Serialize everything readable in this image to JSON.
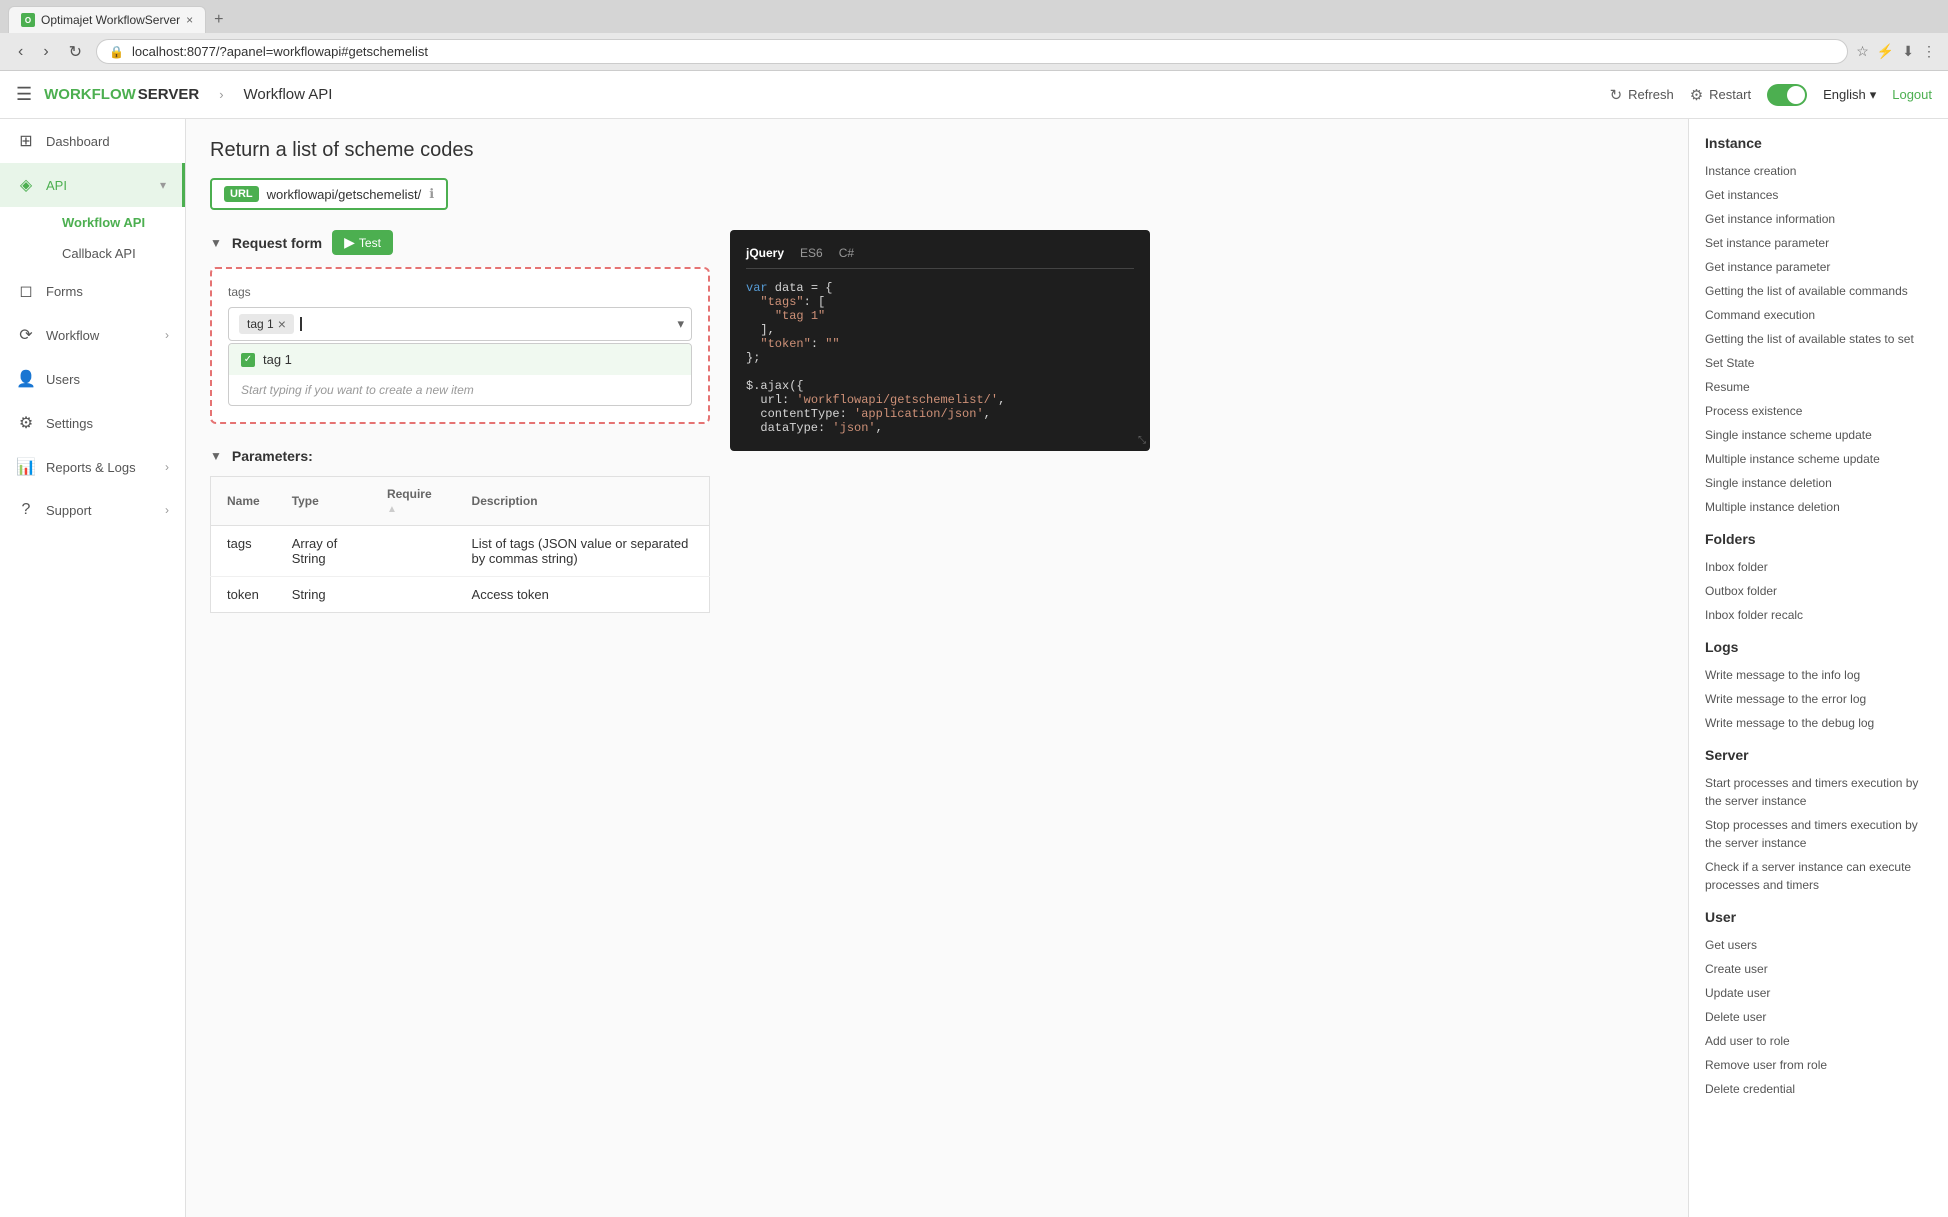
{
  "browser": {
    "tab_favicon": "O",
    "tab_title": "Optimajet WorkflowServer",
    "tab_close": "×",
    "tab_new": "+",
    "address": "localhost:8077/?apanel=workflowapi#getschemelist",
    "nav_back": "‹",
    "nav_forward": "›",
    "nav_reload": "↻"
  },
  "topbar": {
    "menu_icon": "☰",
    "brand_workflow": "WORKFLOW",
    "brand_server": "SERVER",
    "breadcrumb_sep": "›",
    "breadcrumb_page": "Workflow API",
    "refresh_label": "Refresh",
    "restart_label": "Restart",
    "language_label": "English",
    "logout_label": "Logout"
  },
  "sidebar": {
    "items": [
      {
        "id": "dashboard",
        "icon": "⊞",
        "label": "Dashboard",
        "active": false,
        "has_arrow": false
      },
      {
        "id": "api",
        "icon": "◈",
        "label": "API",
        "active": true,
        "has_arrow": true
      },
      {
        "id": "forms",
        "icon": "◻",
        "label": "Forms",
        "active": false,
        "has_arrow": false
      },
      {
        "id": "workflow",
        "icon": "⟳",
        "label": "Workflow",
        "active": false,
        "has_arrow": true
      },
      {
        "id": "users",
        "icon": "👤",
        "label": "Users",
        "active": false,
        "has_arrow": false
      },
      {
        "id": "settings",
        "icon": "⚙",
        "label": "Settings",
        "active": false,
        "has_arrow": false
      },
      {
        "id": "reports",
        "icon": "📊",
        "label": "Reports & Logs",
        "active": false,
        "has_arrow": true
      },
      {
        "id": "support",
        "icon": "?",
        "label": "Support",
        "active": false,
        "has_arrow": true
      }
    ],
    "sub_items": [
      {
        "id": "workflow-api",
        "label": "Workflow API",
        "active": true
      },
      {
        "id": "callback-api",
        "label": "Callback API",
        "active": false
      }
    ]
  },
  "main": {
    "page_title": "Return a list of scheme codes",
    "url_label": "URL",
    "url_value": "workflowapi/getschemelist/",
    "url_info_icon": "ℹ",
    "request_form": {
      "section_label": "Request form",
      "test_btn_label": "Test",
      "test_btn_icon": "▶",
      "tags_label": "tags",
      "tag_chip": "tag 1",
      "tag_chip_remove": "×",
      "dropdown_item_label": "tag 1",
      "dropdown_placeholder": "Start typing if you want to create a new item"
    },
    "code": {
      "tabs": [
        "jQuery",
        "ES6",
        "C#"
      ],
      "active_tab": "jQuery",
      "content_lines": [
        "var data = {",
        "  \"tags\": [",
        "    \"tag 1\"",
        "  ],",
        "  \"token\": \"\"",
        "};",
        "",
        "$.ajax({",
        "  url: 'workflowapi/getschemelist/',",
        "  contentType: 'application/json',",
        "  dataType: 'json',"
      ]
    },
    "parameters": {
      "section_label": "Parameters:",
      "columns": [
        "Name",
        "Type",
        "Require",
        "Description"
      ],
      "rows": [
        {
          "name": "tags",
          "type": "Array of String",
          "required": false,
          "description": "List of tags (JSON value or separated by commas string)"
        },
        {
          "name": "token",
          "type": "String",
          "required": false,
          "description": "Access token"
        }
      ]
    }
  },
  "right_sidebar": {
    "instance": {
      "title": "Instance",
      "links": [
        "Instance creation",
        "Get instances",
        "Get instance information",
        "Set instance parameter",
        "Get instance parameter",
        "Getting the list of available commands",
        "Command execution",
        "Getting the list of available states to set",
        "Set State",
        "Resume",
        "Process existence",
        "Single instance scheme update",
        "Multiple instance scheme update",
        "Single instance deletion",
        "Multiple instance deletion"
      ]
    },
    "folders": {
      "title": "Folders",
      "links": [
        "Inbox folder",
        "Outbox folder",
        "Inbox folder recalc"
      ]
    },
    "logs": {
      "title": "Logs",
      "links": [
        "Write message to the info log",
        "Write message to the error log",
        "Write message to the debug log"
      ]
    },
    "server": {
      "title": "Server",
      "links": [
        "Start processes and timers execution by the server instance",
        "Stop processes and timers execution by the server instance",
        "Check if a server instance can execute processes and timers"
      ]
    },
    "user": {
      "title": "User",
      "links": [
        "Get users",
        "Create user",
        "Update user",
        "Delete user",
        "Add user to role",
        "Remove user from role",
        "Delete credential"
      ]
    }
  }
}
